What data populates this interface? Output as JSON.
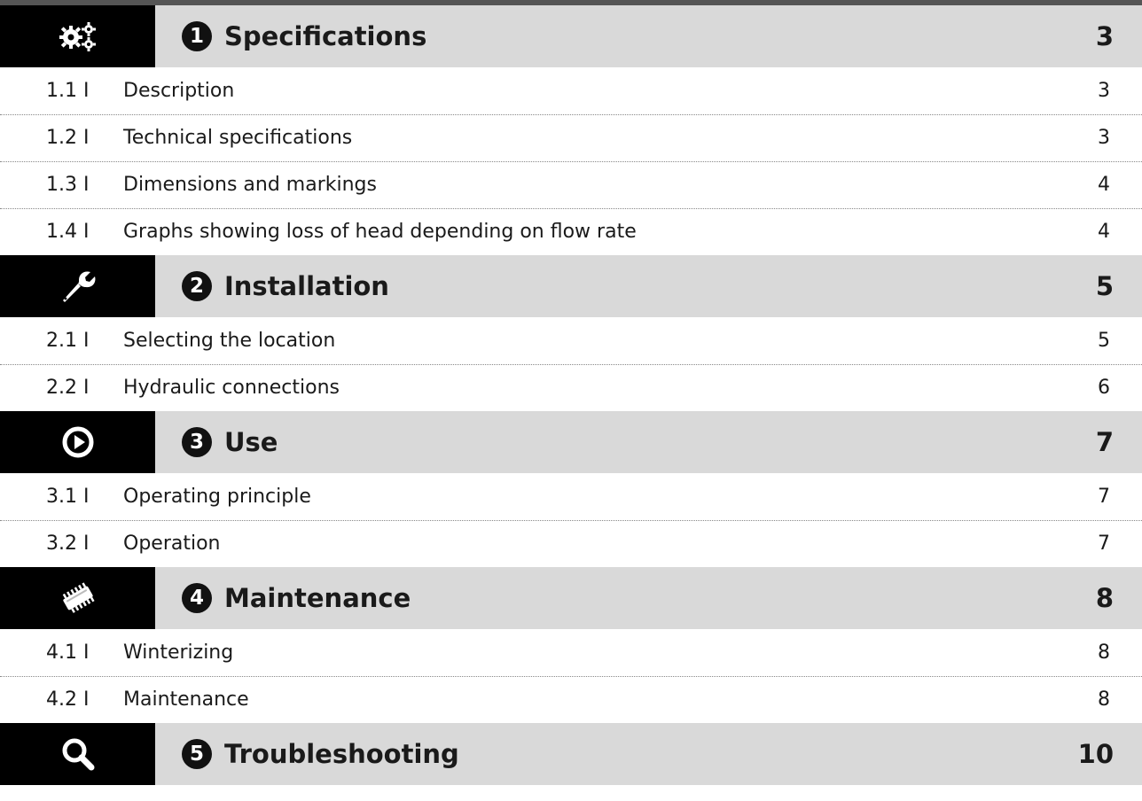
{
  "sections": [
    {
      "icon": "gears-icon",
      "number": "1",
      "title": "Specifications",
      "page": "3",
      "entries": [
        {
          "number": "1.1 I",
          "title": "Description",
          "page": "3"
        },
        {
          "number": "1.2 I",
          "title": "Technical specifications",
          "page": "3"
        },
        {
          "number": "1.3 I",
          "title": "Dimensions and markings",
          "page": "4"
        },
        {
          "number": "1.4 I",
          "title": "Graphs showing loss of head depending on flow rate",
          "page": "4"
        }
      ]
    },
    {
      "icon": "wrench-icon",
      "number": "2",
      "title": "Installation",
      "page": "5",
      "entries": [
        {
          "number": "2.1 I",
          "title": "Selecting the location",
          "page": "5"
        },
        {
          "number": "2.2 I",
          "title": "Hydraulic connections",
          "page": "6"
        }
      ]
    },
    {
      "icon": "play-icon",
      "number": "3",
      "title": "Use",
      "page": "7",
      "entries": [
        {
          "number": "3.1 I",
          "title": "Operating principle",
          "page": "7"
        },
        {
          "number": "3.2 I",
          "title": "Operation",
          "page": "7"
        }
      ]
    },
    {
      "icon": "cartridge-icon",
      "number": "4",
      "title": "Maintenance",
      "page": "8",
      "entries": [
        {
          "number": "4.1 I",
          "title": "Winterizing",
          "page": "8"
        },
        {
          "number": "4.2 I",
          "title": "Maintenance",
          "page": "8"
        }
      ]
    },
    {
      "icon": "magnifier-icon",
      "number": "5",
      "title": "Troubleshooting",
      "page": "10",
      "entries": []
    }
  ],
  "colors": {
    "header_band": "#d9d9d9",
    "icon_box": "#000000",
    "text": "#1a1a1a",
    "divider": "#888888"
  }
}
